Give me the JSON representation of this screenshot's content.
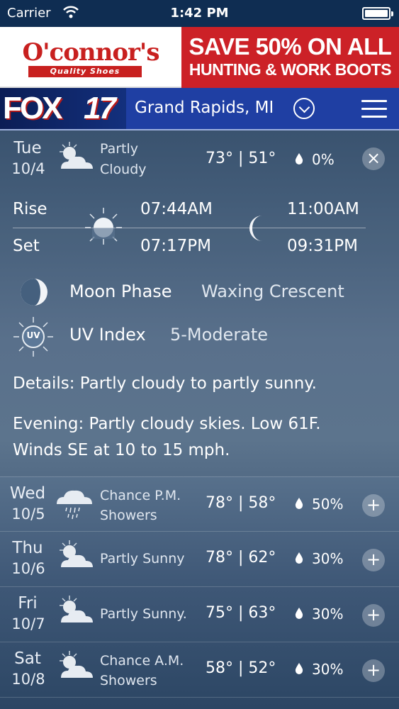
{
  "status_bar": {
    "carrier": "Carrier",
    "time": "1:42 PM"
  },
  "ad": {
    "brand": "O'connor's",
    "tagline": "Quality Shoes",
    "headline": "SAVE 50% ON ALL",
    "subline": "HUNTING & WORK BOOTS"
  },
  "header": {
    "logo_text": "FOX",
    "logo_number": "17",
    "location": "Grand Rapids, MI"
  },
  "today": {
    "day": "Tue",
    "date": "10/4",
    "condition_line1": "Partly",
    "condition_line2": "Cloudy",
    "temps": "73° | 51°",
    "precip": "0%",
    "icon": "partly-cloudy-icon"
  },
  "sun_moon": {
    "rise_label": "Rise",
    "set_label": "Set",
    "sunrise": "07:44AM",
    "sunset": "07:17PM",
    "moonrise": "11:00AM",
    "moonset": "09:31PM"
  },
  "moon_phase": {
    "label": "Moon Phase",
    "value": "Waxing Crescent"
  },
  "uv_index": {
    "label": "UV Index",
    "value": "5-Moderate",
    "badge": "UV"
  },
  "details": "Details: Partly cloudy to partly sunny.",
  "evening_line1": "Evening: Partly cloudy skies. Low 61F.",
  "evening_line2": "Winds SE at 10 to 15 mph.",
  "forecast": [
    {
      "day": "Wed",
      "date": "10/5",
      "cond1": "Chance P.M.",
      "cond2": "Showers",
      "temps": "78° | 58°",
      "precip": "50%",
      "icon": "showers-icon"
    },
    {
      "day": "Thu",
      "date": "10/6",
      "cond1": "Partly Sunny",
      "cond2": "",
      "temps": "78° | 62°",
      "precip": "30%",
      "icon": "partly-sunny-icon"
    },
    {
      "day": "Fri",
      "date": "10/7",
      "cond1": "Partly Sunny.",
      "cond2": "",
      "temps": "75° | 63°",
      "precip": "30%",
      "icon": "partly-sunny-icon"
    },
    {
      "day": "Sat",
      "date": "10/8",
      "cond1": "Chance A.M.",
      "cond2": "Showers",
      "temps": "58° | 52°",
      "precip": "30%",
      "icon": "partly-sunny-icon"
    }
  ],
  "buttons": {
    "close": "×",
    "expand": "+"
  }
}
